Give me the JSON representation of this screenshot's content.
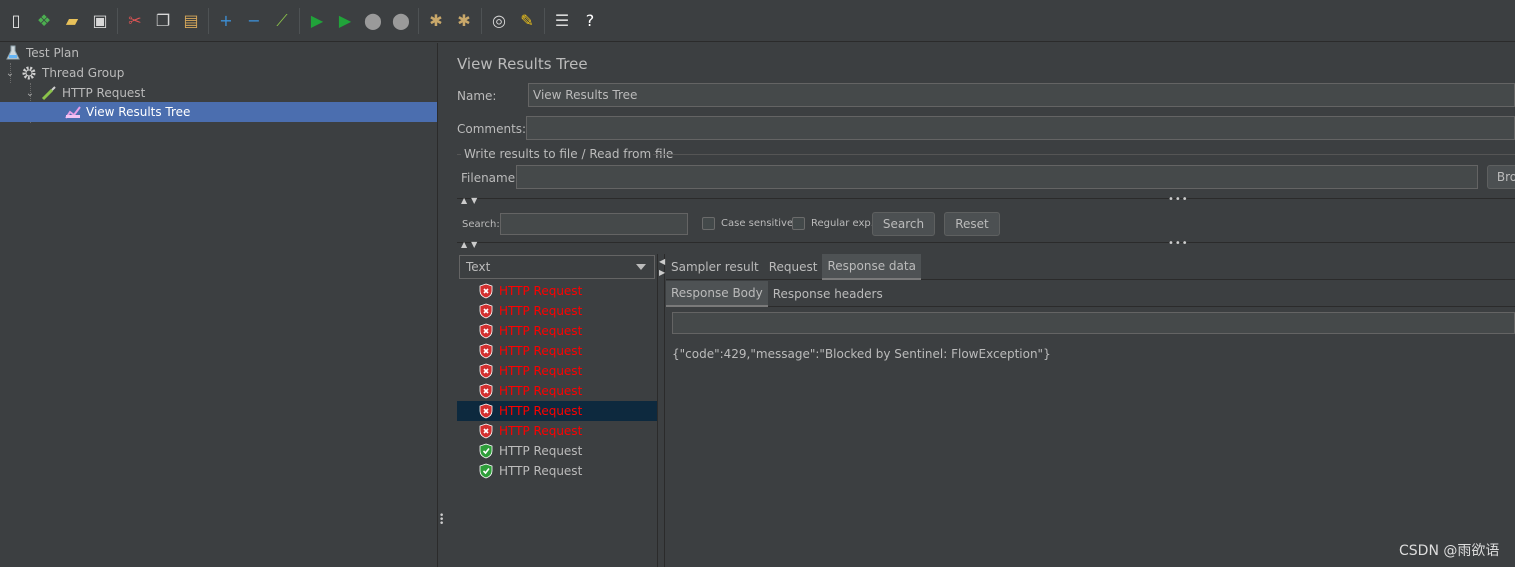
{
  "toolbar": {
    "buttons": [
      {
        "name": "new-icon",
        "glyph": "▯",
        "color": "#e8e8e8"
      },
      {
        "name": "templates-icon",
        "glyph": "❖",
        "color": "#4caf50"
      },
      {
        "name": "open-icon",
        "glyph": "▰",
        "color": "#e8c15a"
      },
      {
        "name": "save-icon",
        "glyph": "▣",
        "color": "#d8d8d8"
      },
      {
        "name": "sep"
      },
      {
        "name": "cut-icon",
        "glyph": "✂",
        "color": "#e05555"
      },
      {
        "name": "copy-icon",
        "glyph": "❐",
        "color": "#d8d8d8"
      },
      {
        "name": "paste-icon",
        "glyph": "▤",
        "color": "#d8a85a"
      },
      {
        "name": "sep"
      },
      {
        "name": "expand-icon",
        "glyph": "+",
        "color": "#3d8fd6"
      },
      {
        "name": "collapse-icon",
        "glyph": "−",
        "color": "#3d8fd6"
      },
      {
        "name": "toggle-icon",
        "glyph": "⟋",
        "color": "#8bc34a"
      },
      {
        "name": "sep"
      },
      {
        "name": "start-icon",
        "glyph": "▶",
        "color": "#21a33a"
      },
      {
        "name": "start-no-pauses-icon",
        "glyph": "▶",
        "color": "#21a33a"
      },
      {
        "name": "stop-icon",
        "glyph": "⬤",
        "color": "#9a9a9a"
      },
      {
        "name": "shutdown-icon",
        "glyph": "⬤",
        "color": "#9a9a9a"
      },
      {
        "name": "sep"
      },
      {
        "name": "clear-icon",
        "glyph": "✱",
        "color": "#c9a86a"
      },
      {
        "name": "clear-all-icon",
        "glyph": "✱",
        "color": "#c9a86a"
      },
      {
        "name": "sep"
      },
      {
        "name": "search-icon",
        "glyph": "◎",
        "color": "#d8d8d8"
      },
      {
        "name": "reset-search-icon",
        "glyph": "✎",
        "color": "#f0c419"
      },
      {
        "name": "sep"
      },
      {
        "name": "function-helper-icon",
        "glyph": "☰",
        "color": "#d8d8d8"
      },
      {
        "name": "help-icon",
        "glyph": "?",
        "color": "#ffffff"
      }
    ]
  },
  "tree": {
    "test_plan": "Test Plan",
    "thread_group": "Thread Group",
    "http_request": "HTTP Request",
    "view_results_tree": "View Results Tree"
  },
  "panel": {
    "title": "View Results Tree",
    "name_label": "Name:",
    "name_value": "View Results Tree",
    "comments_label": "Comments:",
    "fieldset_legend": "Write results to file / Read from file",
    "filename_label": "Filename",
    "browse_label": "Bro"
  },
  "search": {
    "label": "Search:",
    "case_sensitive": "Case sensitive",
    "regular_exp": "Regular exp.",
    "search_button": "Search",
    "reset_button": "Reset"
  },
  "results": {
    "renderer": "Text",
    "items": [
      {
        "label": "HTTP Request",
        "status": "fail"
      },
      {
        "label": "HTTP Request",
        "status": "fail"
      },
      {
        "label": "HTTP Request",
        "status": "fail"
      },
      {
        "label": "HTTP Request",
        "status": "fail"
      },
      {
        "label": "HTTP Request",
        "status": "fail"
      },
      {
        "label": "HTTP Request",
        "status": "fail"
      },
      {
        "label": "HTTP Request",
        "status": "fail",
        "selected": true
      },
      {
        "label": "HTTP Request",
        "status": "fail"
      },
      {
        "label": "HTTP Request",
        "status": "ok"
      },
      {
        "label": "HTTP Request",
        "status": "ok"
      }
    ]
  },
  "tabs": {
    "sampler_result": "Sampler result",
    "request": "Request",
    "response_data": "Response data",
    "response_body": "Response Body",
    "response_headers": "Response headers"
  },
  "response": {
    "body": "{\"code\":429,\"message\":\"Blocked by Sentinel: FlowException\"}"
  },
  "watermark": "CSDN @雨欲语",
  "colors": {
    "fail": "#ff0000",
    "ok": "#bbbbbb",
    "selection": "#4b6eaf",
    "result_selection": "#0d293e"
  }
}
